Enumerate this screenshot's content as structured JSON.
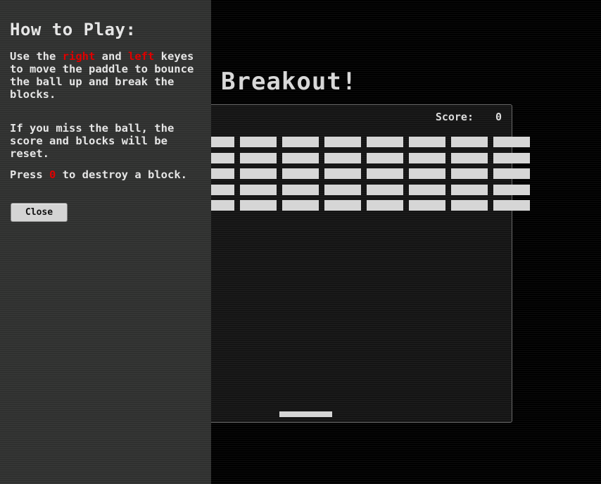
{
  "game": {
    "title": "Breakout!",
    "score_label": "Score:",
    "score_value": "0",
    "brick_rows": 5,
    "brick_columns": 8,
    "colors": {
      "background": "#000000",
      "board": "#141414",
      "brick": "#d6d6d6",
      "panel": "#2f302f",
      "highlight": "#e00000"
    }
  },
  "help": {
    "heading": "How to Play:",
    "p1": {
      "a": "Use the ",
      "b": "right",
      "c": " and ",
      "d": "left",
      "e": " keyes to move the paddle to bounce the ball up and break the blocks."
    },
    "p2": "If you miss the ball, the score and blocks will be reset.",
    "p3": {
      "a": "Press ",
      "b": "0",
      "c": " to destroy a block."
    },
    "close_label": "Close"
  }
}
